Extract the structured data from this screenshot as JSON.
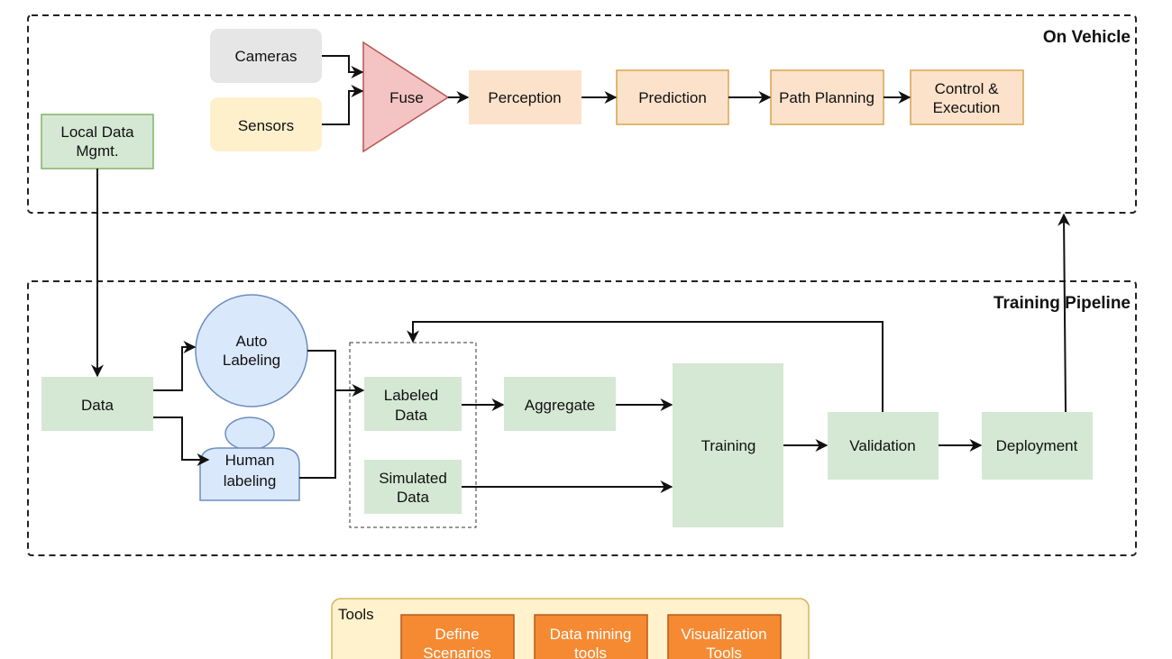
{
  "on_vehicle": {
    "title": "On Vehicle",
    "cameras": "Cameras",
    "sensors": "Sensors",
    "fuse": "Fuse",
    "perception": "Perception",
    "prediction": "Prediction",
    "path_planning": "Path Planning",
    "control_1": "Control &",
    "control_2": "Execution"
  },
  "local_data_1": "Local Data",
  "local_data_2": "Mgmt.",
  "training_pipeline": {
    "title": "Training Pipeline",
    "data": "Data",
    "auto_1": "Auto",
    "auto_2": "Labeling",
    "human_1": "Human",
    "human_2": "labeling",
    "labeled_1": "Labeled",
    "labeled_2": "Data",
    "simulated_1": "Simulated",
    "simulated_2": "Data",
    "aggregate": "Aggregate",
    "training": "Training",
    "validation": "Validation",
    "deployment": "Deployment"
  },
  "tools": {
    "title": "Tools",
    "items": [
      {
        "l1": "Define",
        "l2": "Scenarios"
      },
      {
        "l1": "Data mining",
        "l2": "tools"
      },
      {
        "l1": "Visualization",
        "l2": "Tools"
      }
    ]
  },
  "colors": {
    "green": "#d5e8d4",
    "orange_light": "#fde2cb",
    "blue": "#dae8fc",
    "fuse": "#f4c3c3",
    "tool": "#f58a33"
  }
}
